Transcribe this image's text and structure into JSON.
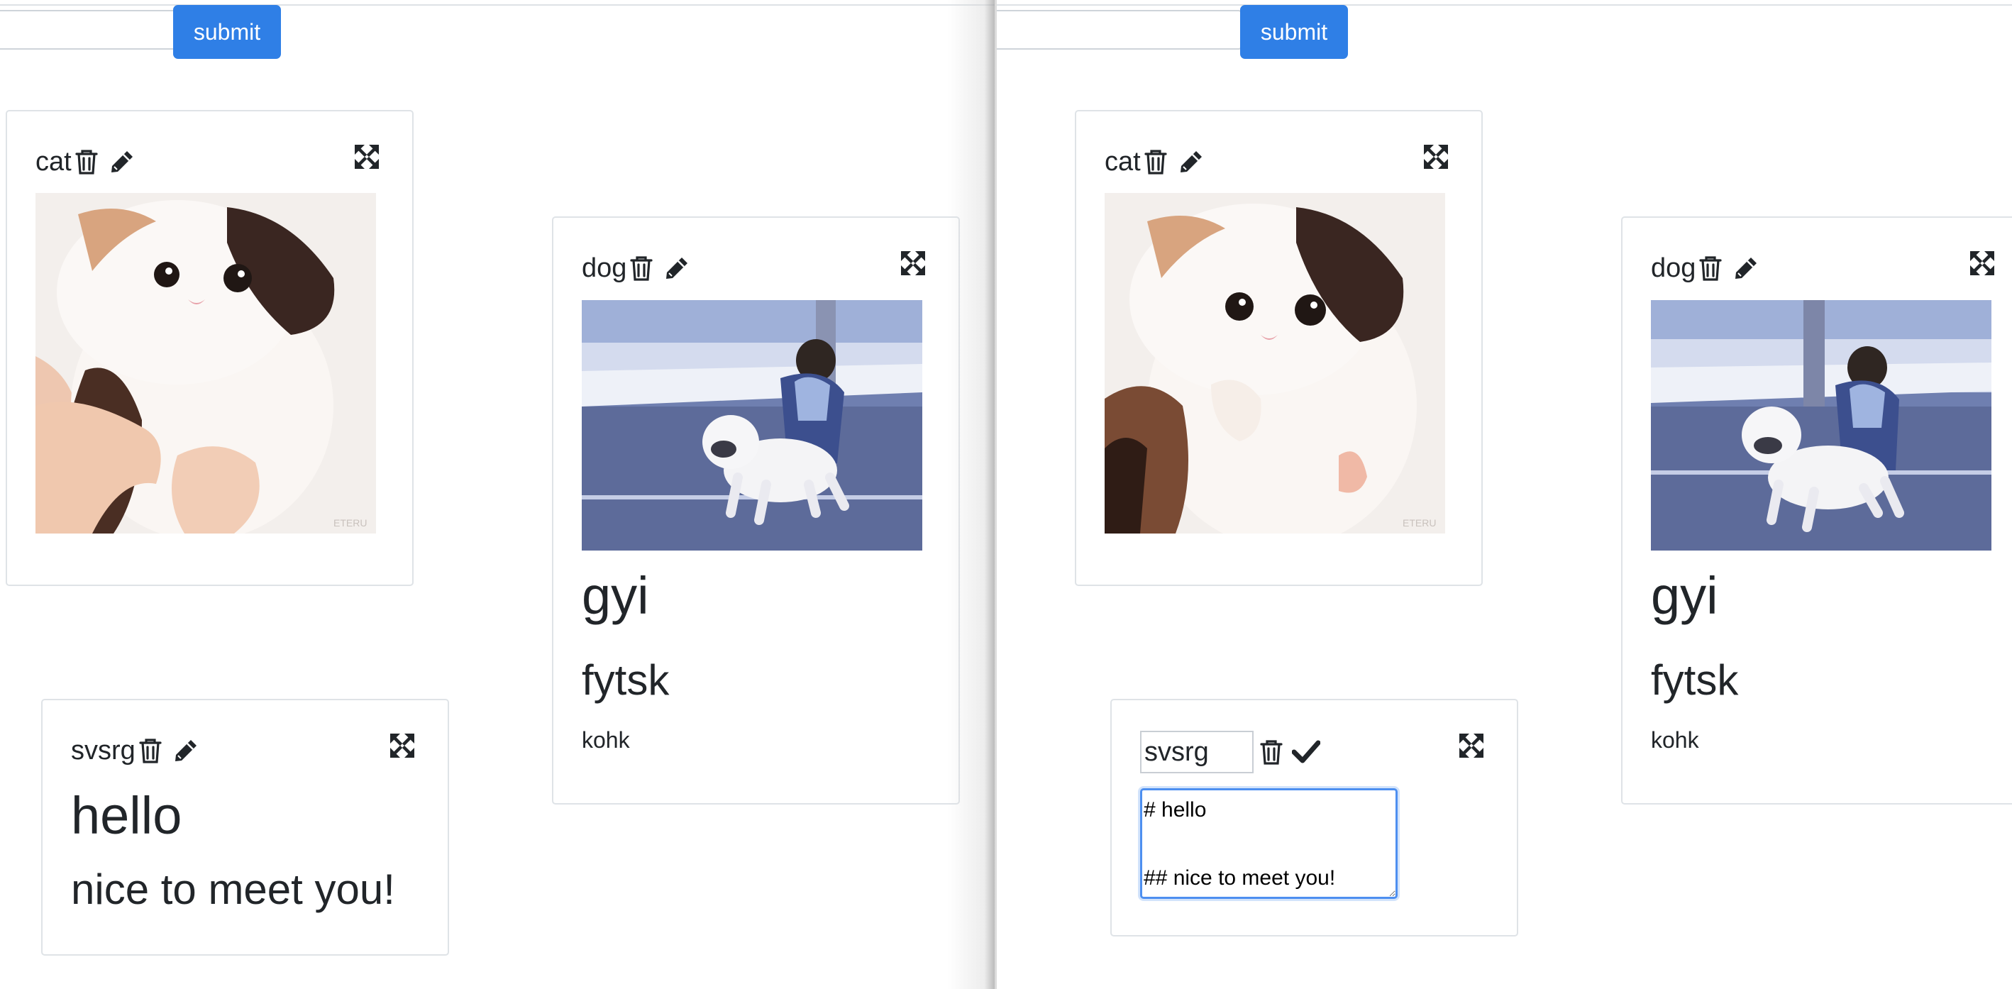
{
  "form": {
    "submit_label": "submit",
    "title_value": ""
  },
  "cards": {
    "cat": {
      "title": "cat",
      "image_alt": "kitten gif",
      "watermark": "ETERU"
    },
    "dog": {
      "title": "dog",
      "image_alt": "dog and chimp gif",
      "heading1": "gyi",
      "heading2": "fytsk",
      "paragraph": "kohk"
    },
    "svsrg": {
      "title": "svsrg",
      "heading1": "hello",
      "heading2": "nice to meet you!",
      "markdown_source": "# hello\n\n## nice to meet you!"
    }
  },
  "icons": {
    "delete": "trash-icon",
    "edit": "pencil-icon",
    "save": "checkmark-icon",
    "expand": "expand-arrows-icon"
  },
  "colors": {
    "primary": "#2f7fe6",
    "focus": "#4d8ff0",
    "border": "#dfe3e7",
    "text": "#212529"
  }
}
